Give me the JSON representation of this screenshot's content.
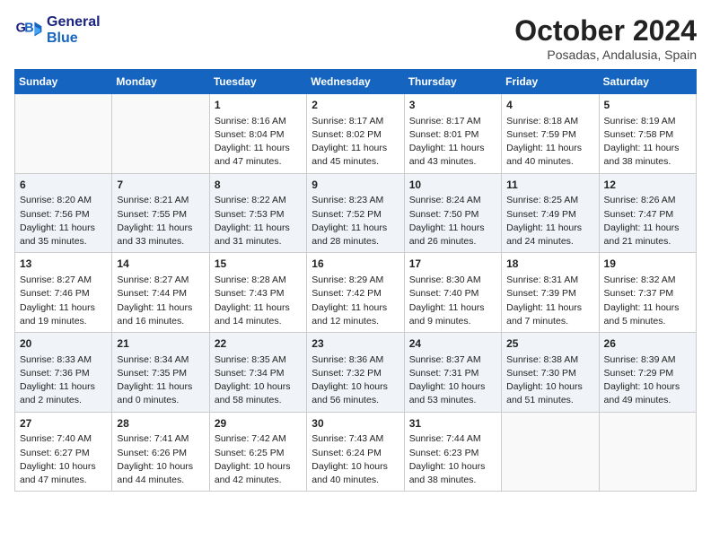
{
  "header": {
    "logo_line1": "General",
    "logo_line2": "Blue",
    "month": "October 2024",
    "location": "Posadas, Andalusia, Spain"
  },
  "days_of_week": [
    "Sunday",
    "Monday",
    "Tuesday",
    "Wednesday",
    "Thursday",
    "Friday",
    "Saturday"
  ],
  "weeks": [
    [
      {
        "day": "",
        "info": ""
      },
      {
        "day": "",
        "info": ""
      },
      {
        "day": "1",
        "info": "Sunrise: 8:16 AM\nSunset: 8:04 PM\nDaylight: 11 hours and 47 minutes."
      },
      {
        "day": "2",
        "info": "Sunrise: 8:17 AM\nSunset: 8:02 PM\nDaylight: 11 hours and 45 minutes."
      },
      {
        "day": "3",
        "info": "Sunrise: 8:17 AM\nSunset: 8:01 PM\nDaylight: 11 hours and 43 minutes."
      },
      {
        "day": "4",
        "info": "Sunrise: 8:18 AM\nSunset: 7:59 PM\nDaylight: 11 hours and 40 minutes."
      },
      {
        "day": "5",
        "info": "Sunrise: 8:19 AM\nSunset: 7:58 PM\nDaylight: 11 hours and 38 minutes."
      }
    ],
    [
      {
        "day": "6",
        "info": "Sunrise: 8:20 AM\nSunset: 7:56 PM\nDaylight: 11 hours and 35 minutes."
      },
      {
        "day": "7",
        "info": "Sunrise: 8:21 AM\nSunset: 7:55 PM\nDaylight: 11 hours and 33 minutes."
      },
      {
        "day": "8",
        "info": "Sunrise: 8:22 AM\nSunset: 7:53 PM\nDaylight: 11 hours and 31 minutes."
      },
      {
        "day": "9",
        "info": "Sunrise: 8:23 AM\nSunset: 7:52 PM\nDaylight: 11 hours and 28 minutes."
      },
      {
        "day": "10",
        "info": "Sunrise: 8:24 AM\nSunset: 7:50 PM\nDaylight: 11 hours and 26 minutes."
      },
      {
        "day": "11",
        "info": "Sunrise: 8:25 AM\nSunset: 7:49 PM\nDaylight: 11 hours and 24 minutes."
      },
      {
        "day": "12",
        "info": "Sunrise: 8:26 AM\nSunset: 7:47 PM\nDaylight: 11 hours and 21 minutes."
      }
    ],
    [
      {
        "day": "13",
        "info": "Sunrise: 8:27 AM\nSunset: 7:46 PM\nDaylight: 11 hours and 19 minutes."
      },
      {
        "day": "14",
        "info": "Sunrise: 8:27 AM\nSunset: 7:44 PM\nDaylight: 11 hours and 16 minutes."
      },
      {
        "day": "15",
        "info": "Sunrise: 8:28 AM\nSunset: 7:43 PM\nDaylight: 11 hours and 14 minutes."
      },
      {
        "day": "16",
        "info": "Sunrise: 8:29 AM\nSunset: 7:42 PM\nDaylight: 11 hours and 12 minutes."
      },
      {
        "day": "17",
        "info": "Sunrise: 8:30 AM\nSunset: 7:40 PM\nDaylight: 11 hours and 9 minutes."
      },
      {
        "day": "18",
        "info": "Sunrise: 8:31 AM\nSunset: 7:39 PM\nDaylight: 11 hours and 7 minutes."
      },
      {
        "day": "19",
        "info": "Sunrise: 8:32 AM\nSunset: 7:37 PM\nDaylight: 11 hours and 5 minutes."
      }
    ],
    [
      {
        "day": "20",
        "info": "Sunrise: 8:33 AM\nSunset: 7:36 PM\nDaylight: 11 hours and 2 minutes."
      },
      {
        "day": "21",
        "info": "Sunrise: 8:34 AM\nSunset: 7:35 PM\nDaylight: 11 hours and 0 minutes."
      },
      {
        "day": "22",
        "info": "Sunrise: 8:35 AM\nSunset: 7:34 PM\nDaylight: 10 hours and 58 minutes."
      },
      {
        "day": "23",
        "info": "Sunrise: 8:36 AM\nSunset: 7:32 PM\nDaylight: 10 hours and 56 minutes."
      },
      {
        "day": "24",
        "info": "Sunrise: 8:37 AM\nSunset: 7:31 PM\nDaylight: 10 hours and 53 minutes."
      },
      {
        "day": "25",
        "info": "Sunrise: 8:38 AM\nSunset: 7:30 PM\nDaylight: 10 hours and 51 minutes."
      },
      {
        "day": "26",
        "info": "Sunrise: 8:39 AM\nSunset: 7:29 PM\nDaylight: 10 hours and 49 minutes."
      }
    ],
    [
      {
        "day": "27",
        "info": "Sunrise: 7:40 AM\nSunset: 6:27 PM\nDaylight: 10 hours and 47 minutes."
      },
      {
        "day": "28",
        "info": "Sunrise: 7:41 AM\nSunset: 6:26 PM\nDaylight: 10 hours and 44 minutes."
      },
      {
        "day": "29",
        "info": "Sunrise: 7:42 AM\nSunset: 6:25 PM\nDaylight: 10 hours and 42 minutes."
      },
      {
        "day": "30",
        "info": "Sunrise: 7:43 AM\nSunset: 6:24 PM\nDaylight: 10 hours and 40 minutes."
      },
      {
        "day": "31",
        "info": "Sunrise: 7:44 AM\nSunset: 6:23 PM\nDaylight: 10 hours and 38 minutes."
      },
      {
        "day": "",
        "info": ""
      },
      {
        "day": "",
        "info": ""
      }
    ]
  ]
}
